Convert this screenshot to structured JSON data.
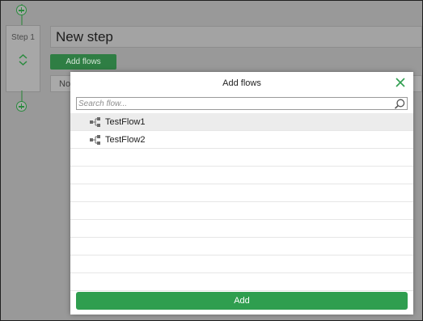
{
  "editor": {
    "step_label": "Step 1",
    "step_title": "New step",
    "add_flows_button": "Add flows",
    "row_text": "No"
  },
  "modal": {
    "title": "Add flows",
    "search": {
      "placeholder": "Search flow...",
      "value": ""
    },
    "flows": [
      {
        "label": "TestFlow1",
        "selected": true
      },
      {
        "label": "TestFlow2",
        "selected": false
      }
    ],
    "add_button": "Add"
  },
  "colors": {
    "accent_green": "#2f9e4f",
    "overlay_gray": "#999999"
  }
}
